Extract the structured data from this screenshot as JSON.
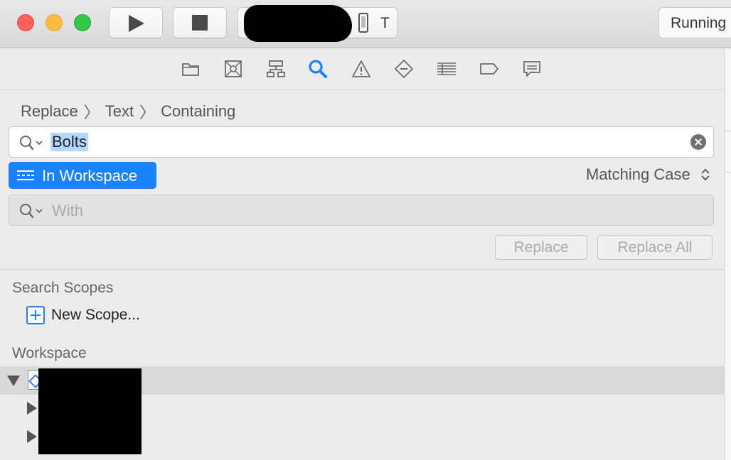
{
  "toolbar": {
    "run_icon": "play-icon",
    "stop_icon": "stop-icon",
    "scheme_destination": "T",
    "status_text": "Running"
  },
  "navigator": {
    "icons": [
      "folder-icon",
      "source-control-icon",
      "hierarchy-icon",
      "find-icon",
      "issue-icon",
      "test-icon",
      "debug-icon",
      "breakpoint-icon",
      "report-icon"
    ],
    "selected": "find-icon"
  },
  "find": {
    "breadcrumb": [
      "Replace",
      "Text",
      "Containing"
    ],
    "search_value": "Bolts",
    "scope_label": "In Workspace",
    "matching_label": "Matching Case",
    "replace_placeholder": "With",
    "replace_button": "Replace",
    "replace_all_button": "Replace All"
  },
  "scopes": {
    "heading": "Search Scopes",
    "new_scope": "New Scope..."
  },
  "workspace": {
    "heading": "Workspace"
  },
  "colors": {
    "accent": "#1a82fb",
    "selection": "#b3d7ff"
  }
}
